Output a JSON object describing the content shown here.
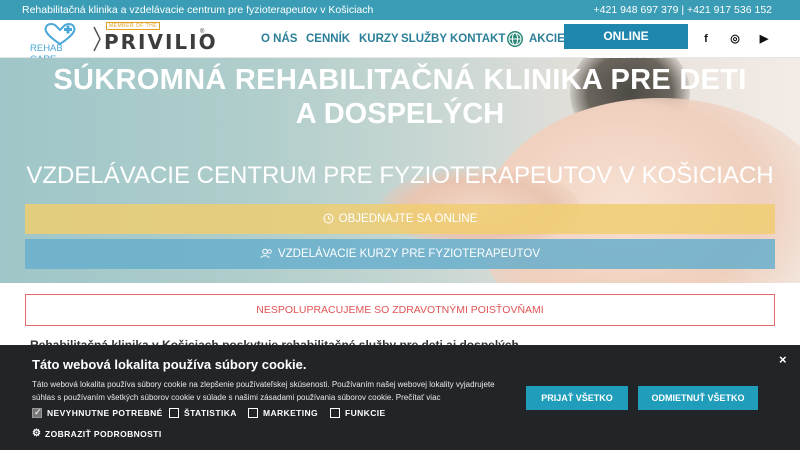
{
  "topbar": {
    "tagline": "Rehabilitačná klinika a vzdelávacie centrum pre fyzioterapeutov v Košiciach",
    "phones": "+421 948 697 379 | +421 917 536 152"
  },
  "logos": {
    "rehab_care": "REHAB CARE",
    "privilio_badge": "MEMBER OF THE",
    "privilio": "PRIVILIO",
    "registered": "®"
  },
  "nav": {
    "items": [
      "O NÁS",
      "CENNÍK",
      "KURZY",
      "SLUŽBY",
      "KONTAKT"
    ],
    "akcie": "AKCIE",
    "reserve_button": "ONLINE REZERVÁCIA",
    "social": [
      "f",
      "◎",
      "▶"
    ]
  },
  "hero": {
    "title_line1": "SÚKROMNÁ REHABILITAČNÁ KLINIKA PRE DETI",
    "title_line2": "A DOSPELÝCH",
    "subtitle": "VZDELÁVACIE CENTRUM PRE FYZIOTERAPEUTOV V KOŠICIACH",
    "cta_order": "OBJEDNAJTE SA ONLINE",
    "cta_courses": "VZDELÁVACIE KURZY PRE FYZIOTERAPEUTOV"
  },
  "notice": "NESPOLUPRACUJEME SO ZDRAVOTNÝMI POISŤOVŇAMI",
  "partial_text": "Rehabilitačná klinika v Košiciach poskytuje rehabilitačné služby pre deti aj dospelých",
  "cookie": {
    "title": "Táto webová lokalita používa súbory cookie.",
    "description": "Táto webová lokalita používa súbory cookie na zlepšenie používateľskej skúsenosti. Používaním našej webovej lokality vyjadrujete súhlas s používaním všetkých súborov cookie v súlade s našimi zásadami používania súborov cookie. Prečítať viac",
    "accept_all": "PRIJAŤ VŠETKO",
    "reject_all": "ODMIETNUŤ VŠETKO",
    "close": "×",
    "checkboxes": [
      {
        "label": "NEVYHNUTNE POTREBNÉ",
        "checked": true
      },
      {
        "label": "ŠTATISTIKA",
        "checked": false
      },
      {
        "label": "MARKETING",
        "checked": false
      },
      {
        "label": "FUNKCIE",
        "checked": false
      }
    ],
    "show_details": "ZOBRAZIŤ PODROBNOSTI"
  },
  "colors": {
    "topbar": "#3a9db5",
    "nav_text": "#2b7f99",
    "reserve_button": "#1f87ad",
    "cta_order": "#f0cd6e",
    "cta_courses": "#69afcd",
    "notice_border": "#e46a6a",
    "cookie_bg": "#222528",
    "cookie_button": "#1f9dbb"
  }
}
